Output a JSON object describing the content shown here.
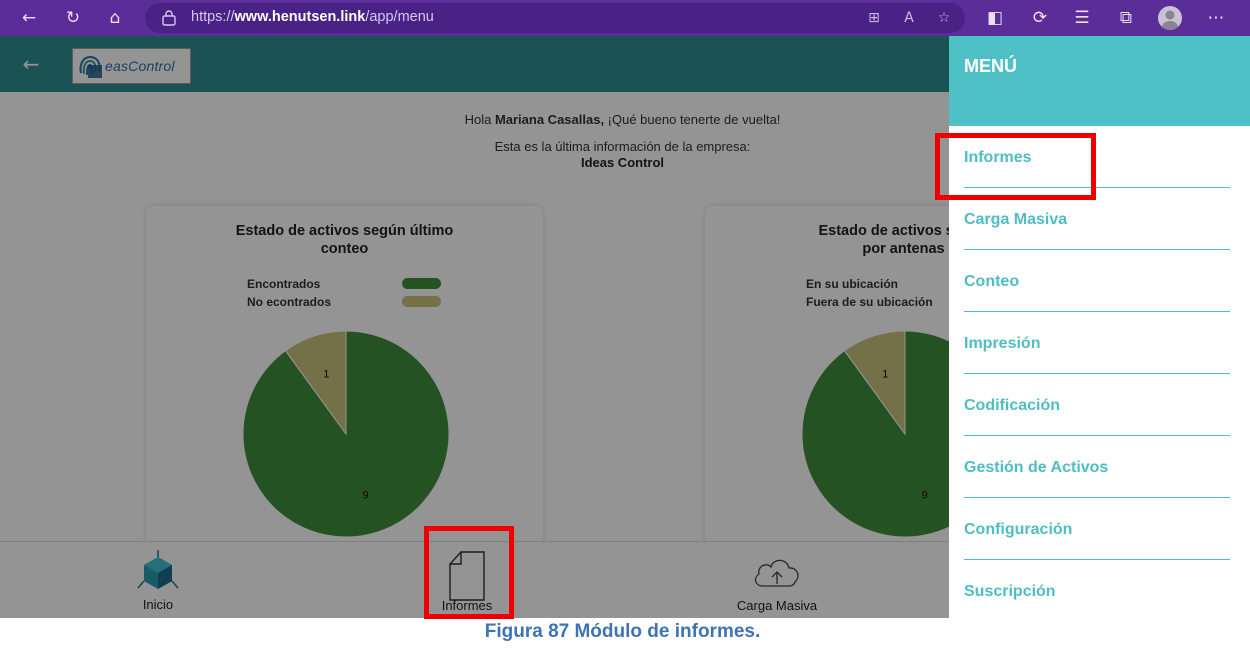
{
  "browser": {
    "url_prefix": "https://",
    "url_domain": "www.henutsen.link",
    "url_path": "/app/menu",
    "toolbar_icons": [
      "back-icon",
      "refresh-icon",
      "home-icon",
      "lock-icon",
      "grid-icon",
      "read-aloud-icon",
      "add-favorite-icon",
      "extensions-icon",
      "copilot-icon",
      "favorites-icon",
      "collections-icon",
      "profile-icon",
      "more-icon"
    ]
  },
  "header": {
    "logo_text": "easControl"
  },
  "main": {
    "greeting_prefix": "Hola ",
    "user_name": "Mariana Casallas,",
    "greeting_suffix": " ¡Qué bueno tenerte de vuelta!",
    "company_intro": "Esta es la última información de la empresa:",
    "company_name": "Ideas Control"
  },
  "cards": [
    {
      "title_line1": "Estado de activos según último",
      "title_line2": "conteo",
      "legend": [
        {
          "label": "Encontrados",
          "color": "#3e8e3b"
        },
        {
          "label": "No econtrados",
          "color": "#c9c27c"
        }
      ]
    },
    {
      "title_line1": "Estado de activos según",
      "title_line2": "por antenas",
      "legend": [
        {
          "label": "En su ubicación",
          "color": "#3e8e3b"
        },
        {
          "label": "Fuera de su ubicación",
          "color": "#c9c27c"
        }
      ]
    }
  ],
  "chart_data": [
    {
      "type": "pie",
      "title": "Estado de activos según último conteo",
      "categories": [
        "Encontrados",
        "No econtrados"
      ],
      "values": [
        9,
        1
      ],
      "colors": [
        "#3e8e3b",
        "#c9c27c"
      ],
      "legend_position": "top"
    },
    {
      "type": "pie",
      "title": "Estado de activos según por antenas",
      "categories": [
        "En su ubicación",
        "Fuera de su ubicación"
      ],
      "values": [
        9,
        1
      ],
      "colors": [
        "#3e8e3b",
        "#c9c27c"
      ],
      "legend_position": "top"
    }
  ],
  "bottom_nav": [
    {
      "label": "Inicio",
      "icon": "cube-icon"
    },
    {
      "label": "Informes",
      "icon": "document-icon"
    },
    {
      "label": "Carga Masiva",
      "icon": "cloud-upload-icon"
    }
  ],
  "menu": {
    "title": "MENÚ",
    "items": [
      {
        "label": "Informes"
      },
      {
        "label": "Carga Masiva"
      },
      {
        "label": "Conteo"
      },
      {
        "label": "Impresión"
      },
      {
        "label": "Codificación"
      },
      {
        "label": "Gestión de Activos"
      },
      {
        "label": "Configuración"
      },
      {
        "label": "Suscripción"
      }
    ]
  },
  "caption": "Figura 87 Módulo de informes.",
  "colors": {
    "browser": "#5b2d99",
    "header_teal": "#2f8f93",
    "menu_teal": "#4fc0c5",
    "highlight_red": "#ee0000",
    "caption_blue": "#3e73b6"
  }
}
